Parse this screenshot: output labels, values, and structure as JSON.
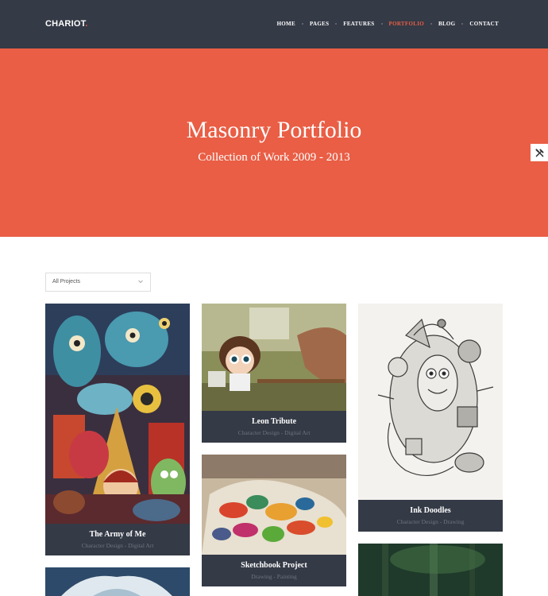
{
  "brand": {
    "name": "CHARIOT",
    "dot": "."
  },
  "nav": [
    {
      "label": "HOME",
      "active": false
    },
    {
      "label": "PAGES",
      "active": false
    },
    {
      "label": "FEATURES",
      "active": false
    },
    {
      "label": "PORTFOLIO",
      "active": true
    },
    {
      "label": "BLOG",
      "active": false
    },
    {
      "label": "CONTACT",
      "active": false
    }
  ],
  "hero": {
    "title": "Masonry Portfolio",
    "subtitle": "Collection of Work 2009 - 2013"
  },
  "filter": {
    "selected": "All Projects"
  },
  "projects": [
    {
      "title": "The Army of Me",
      "category": "Character Design - Digital Art"
    },
    {
      "title": "Leon Tribute",
      "category": "Character Design - Digital Art"
    },
    {
      "title": "Ink Doodles",
      "category": "Character Design - Drawing"
    },
    {
      "title": "Sketchbook Project",
      "category": "Drawing - Painting"
    }
  ],
  "icons": {
    "tool": "tools-icon",
    "chevron": "chevron-down-icon"
  },
  "colors": {
    "accent": "#e95e45",
    "dark": "#343a46",
    "muted": "#6e7480"
  }
}
